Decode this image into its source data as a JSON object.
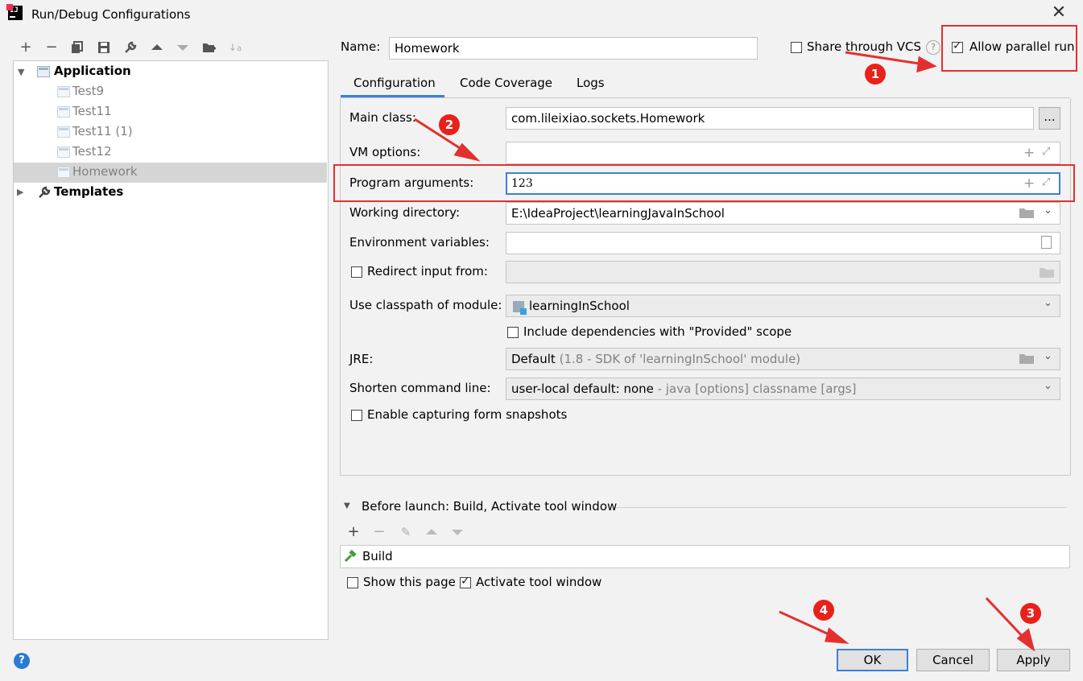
{
  "window": {
    "title": "Run/Debug Configurations"
  },
  "tree": {
    "group_application": "Application",
    "items": [
      {
        "label": "Test9"
      },
      {
        "label": "Test11"
      },
      {
        "label": "Test11 (1)"
      },
      {
        "label": "Test12"
      },
      {
        "label": "Homework"
      }
    ],
    "group_templates": "Templates"
  },
  "form": {
    "name_label": "Name:",
    "name_value": "Homework",
    "share_vcs_label": "Share through VCS",
    "parallel_label": "Allow parallel run",
    "tabs": [
      {
        "label": "Configuration"
      },
      {
        "label": "Code Coverage"
      },
      {
        "label": "Logs"
      }
    ],
    "main_class_label": "Main class:",
    "main_class_value": "com.lileixiao.sockets.Homework",
    "browse_label": "...",
    "vm_options_label": "VM options:",
    "vm_options_value": "",
    "program_args_label": "Program arguments:",
    "program_args_value": "123",
    "working_dir_label": "Working directory:",
    "working_dir_value": "E:\\IdeaProject\\learningJavaInSchool",
    "env_vars_label": "Environment variables:",
    "env_vars_value": "",
    "redirect_label": "Redirect input from:",
    "classpath_label": "Use classpath of module:",
    "classpath_value": "learningInSchool",
    "include_deps_label": "Include dependencies with \"Provided\" scope",
    "jre_label": "JRE:",
    "jre_value": "Default",
    "jre_hint": "(1.8 - SDK of 'learningInSchool' module)",
    "shorten_label": "Shorten command line:",
    "shorten_value": "user-local default: none",
    "shorten_hint": "- java [options] classname [args]",
    "capture_label": "Enable capturing form snapshots"
  },
  "before_launch": {
    "title": "Before launch: Build, Activate tool window",
    "item_build": "Build",
    "show_page_label": "Show this page",
    "activate_label": "Activate tool window"
  },
  "buttons": {
    "ok": "OK",
    "cancel": "Cancel",
    "apply": "Apply"
  },
  "annotations": {
    "b1": "1",
    "b2": "2",
    "b3": "3",
    "b4": "4"
  },
  "colors": {
    "accent": "#3d7fd9",
    "annotation_red": "#e3302f"
  }
}
